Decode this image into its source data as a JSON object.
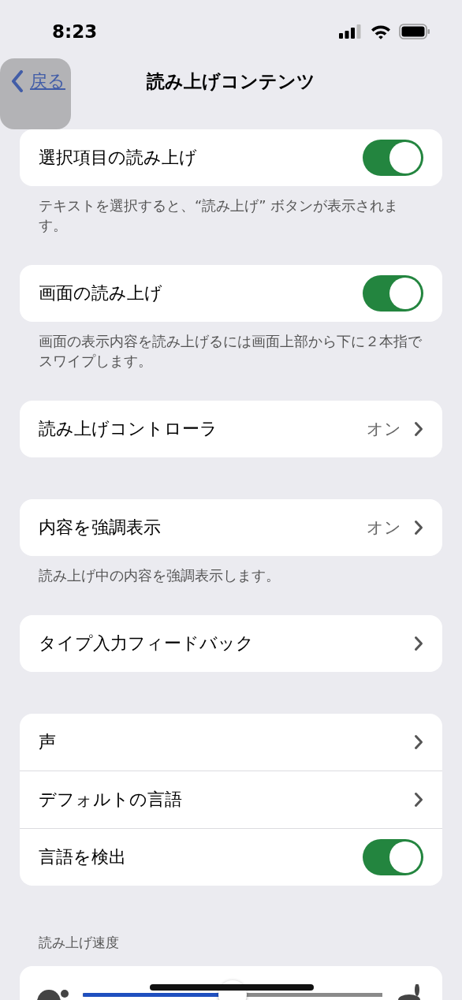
{
  "status_bar": {
    "time": "8:23"
  },
  "nav": {
    "back": "戻る",
    "title": "読み上げコンテンツ"
  },
  "groups": [
    {
      "rows": [
        {
          "kind": "toggle",
          "label": "選択項目の読み上げ",
          "on": true
        }
      ],
      "footer": "テキストを選択すると、“読み上げ” ボタンが表示されます。"
    },
    {
      "rows": [
        {
          "kind": "toggle",
          "label": "画面の読み上げ",
          "on": true
        }
      ],
      "footer": "画面の表示内容を読み上げるには画面上部から下に２本指でスワイプします。"
    },
    {
      "rows": [
        {
          "kind": "link",
          "label": "読み上げコントローラ",
          "value": "オン"
        }
      ]
    },
    {
      "rows": [
        {
          "kind": "link",
          "label": "内容を強調表示",
          "value": "オン"
        }
      ],
      "footer": "読み上げ中の内容を強調表示します。"
    },
    {
      "rows": [
        {
          "kind": "link",
          "label": "タイプ入力フィードバック"
        }
      ]
    },
    {
      "rows": [
        {
          "kind": "link",
          "label": "声"
        },
        {
          "kind": "link",
          "label": "デフォルトの言語"
        },
        {
          "kind": "toggle",
          "label": "言語を検出",
          "on": true
        }
      ]
    },
    {
      "header": "読み上げ速度",
      "rows": [
        {
          "kind": "slider",
          "level": 0.5
        }
      ]
    }
  ]
}
